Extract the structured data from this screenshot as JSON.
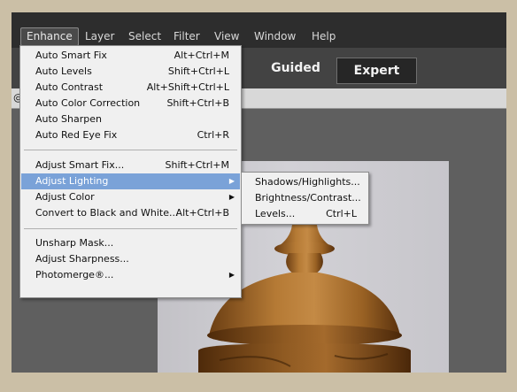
{
  "menubar": {
    "items": [
      {
        "label": "Enhance"
      },
      {
        "label": "Layer"
      },
      {
        "label": "Select"
      },
      {
        "label": "Filter"
      },
      {
        "label": "View"
      },
      {
        "label": "Window"
      },
      {
        "label": "Help"
      }
    ]
  },
  "modes": {
    "guided": "Guided",
    "expert": "Expert"
  },
  "docbar": {
    "tab_prefix": "@"
  },
  "enhance_menu": {
    "items": [
      {
        "label": "Auto Smart Fix",
        "shortcut": "Alt+Ctrl+M"
      },
      {
        "label": "Auto Levels",
        "shortcut": "Shift+Ctrl+L"
      },
      {
        "label": "Auto Contrast",
        "shortcut": "Alt+Shift+Ctrl+L"
      },
      {
        "label": "Auto Color Correction",
        "shortcut": "Shift+Ctrl+B"
      },
      {
        "label": "Auto Sharpen",
        "shortcut": ""
      },
      {
        "label": "Auto Red Eye Fix",
        "shortcut": "Ctrl+R"
      },
      {
        "label": "Adjust Smart Fix...",
        "shortcut": "Shift+Ctrl+M"
      },
      {
        "label": "Adjust Lighting",
        "shortcut": ""
      },
      {
        "label": "Adjust Color",
        "shortcut": ""
      },
      {
        "label": "Convert to Black and White...",
        "shortcut": "Alt+Ctrl+B"
      },
      {
        "label": "Unsharp Mask...",
        "shortcut": ""
      },
      {
        "label": "Adjust Sharpness...",
        "shortcut": ""
      },
      {
        "label": "Photomerge®...",
        "shortcut": ""
      }
    ],
    "submenu_arrow": "▶"
  },
  "lighting_submenu": {
    "items": [
      {
        "label": "Shadows/Highlights...",
        "shortcut": ""
      },
      {
        "label": "Brightness/Contrast...",
        "shortcut": ""
      },
      {
        "label": "Levels...",
        "shortcut": "Ctrl+L"
      }
    ]
  },
  "colors": {
    "frame": "#cbbfa6",
    "menubar": "#2d2d2d",
    "highlight": "#7aa2d8",
    "menu_bg": "#f0f0f0"
  },
  "icons": [
    "submenu-arrow-icon"
  ]
}
